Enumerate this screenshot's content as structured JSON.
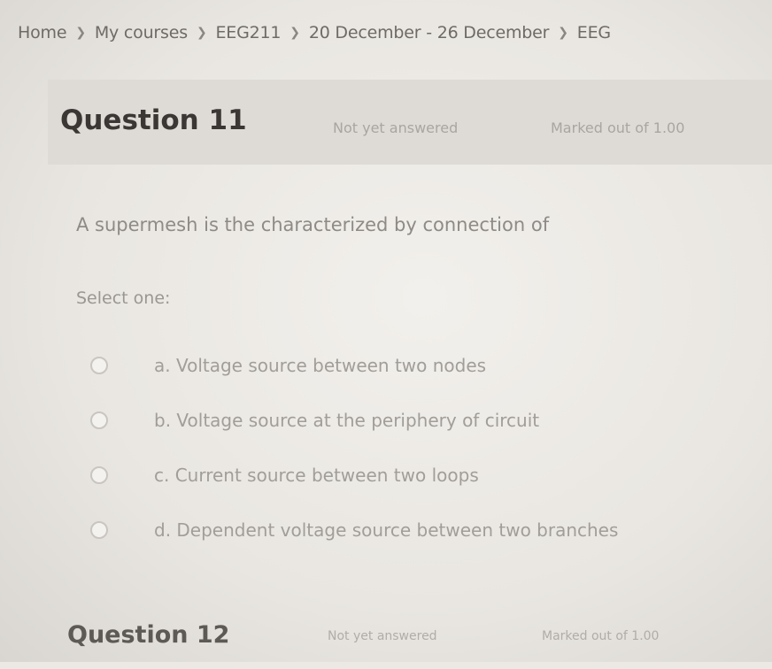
{
  "breadcrumb": {
    "items": [
      "Home",
      "My courses",
      "EEG211",
      "20 December - 26 December",
      "EEG"
    ]
  },
  "question11": {
    "title": "Question 11",
    "state": "Not yet answered",
    "grade": "Marked out of 1.00",
    "text": "A supermesh is the characterized by connection of",
    "prompt": "Select one:",
    "options": [
      {
        "label": "a. Voltage source between two nodes"
      },
      {
        "label": "b. Voltage source at the periphery of circuit"
      },
      {
        "label": "c. Current source between two loops"
      },
      {
        "label": "d. Dependent voltage source between two branches"
      }
    ]
  },
  "question12": {
    "title": "Question 12",
    "state": "Not yet answered",
    "grade": "Marked out of 1.00"
  }
}
